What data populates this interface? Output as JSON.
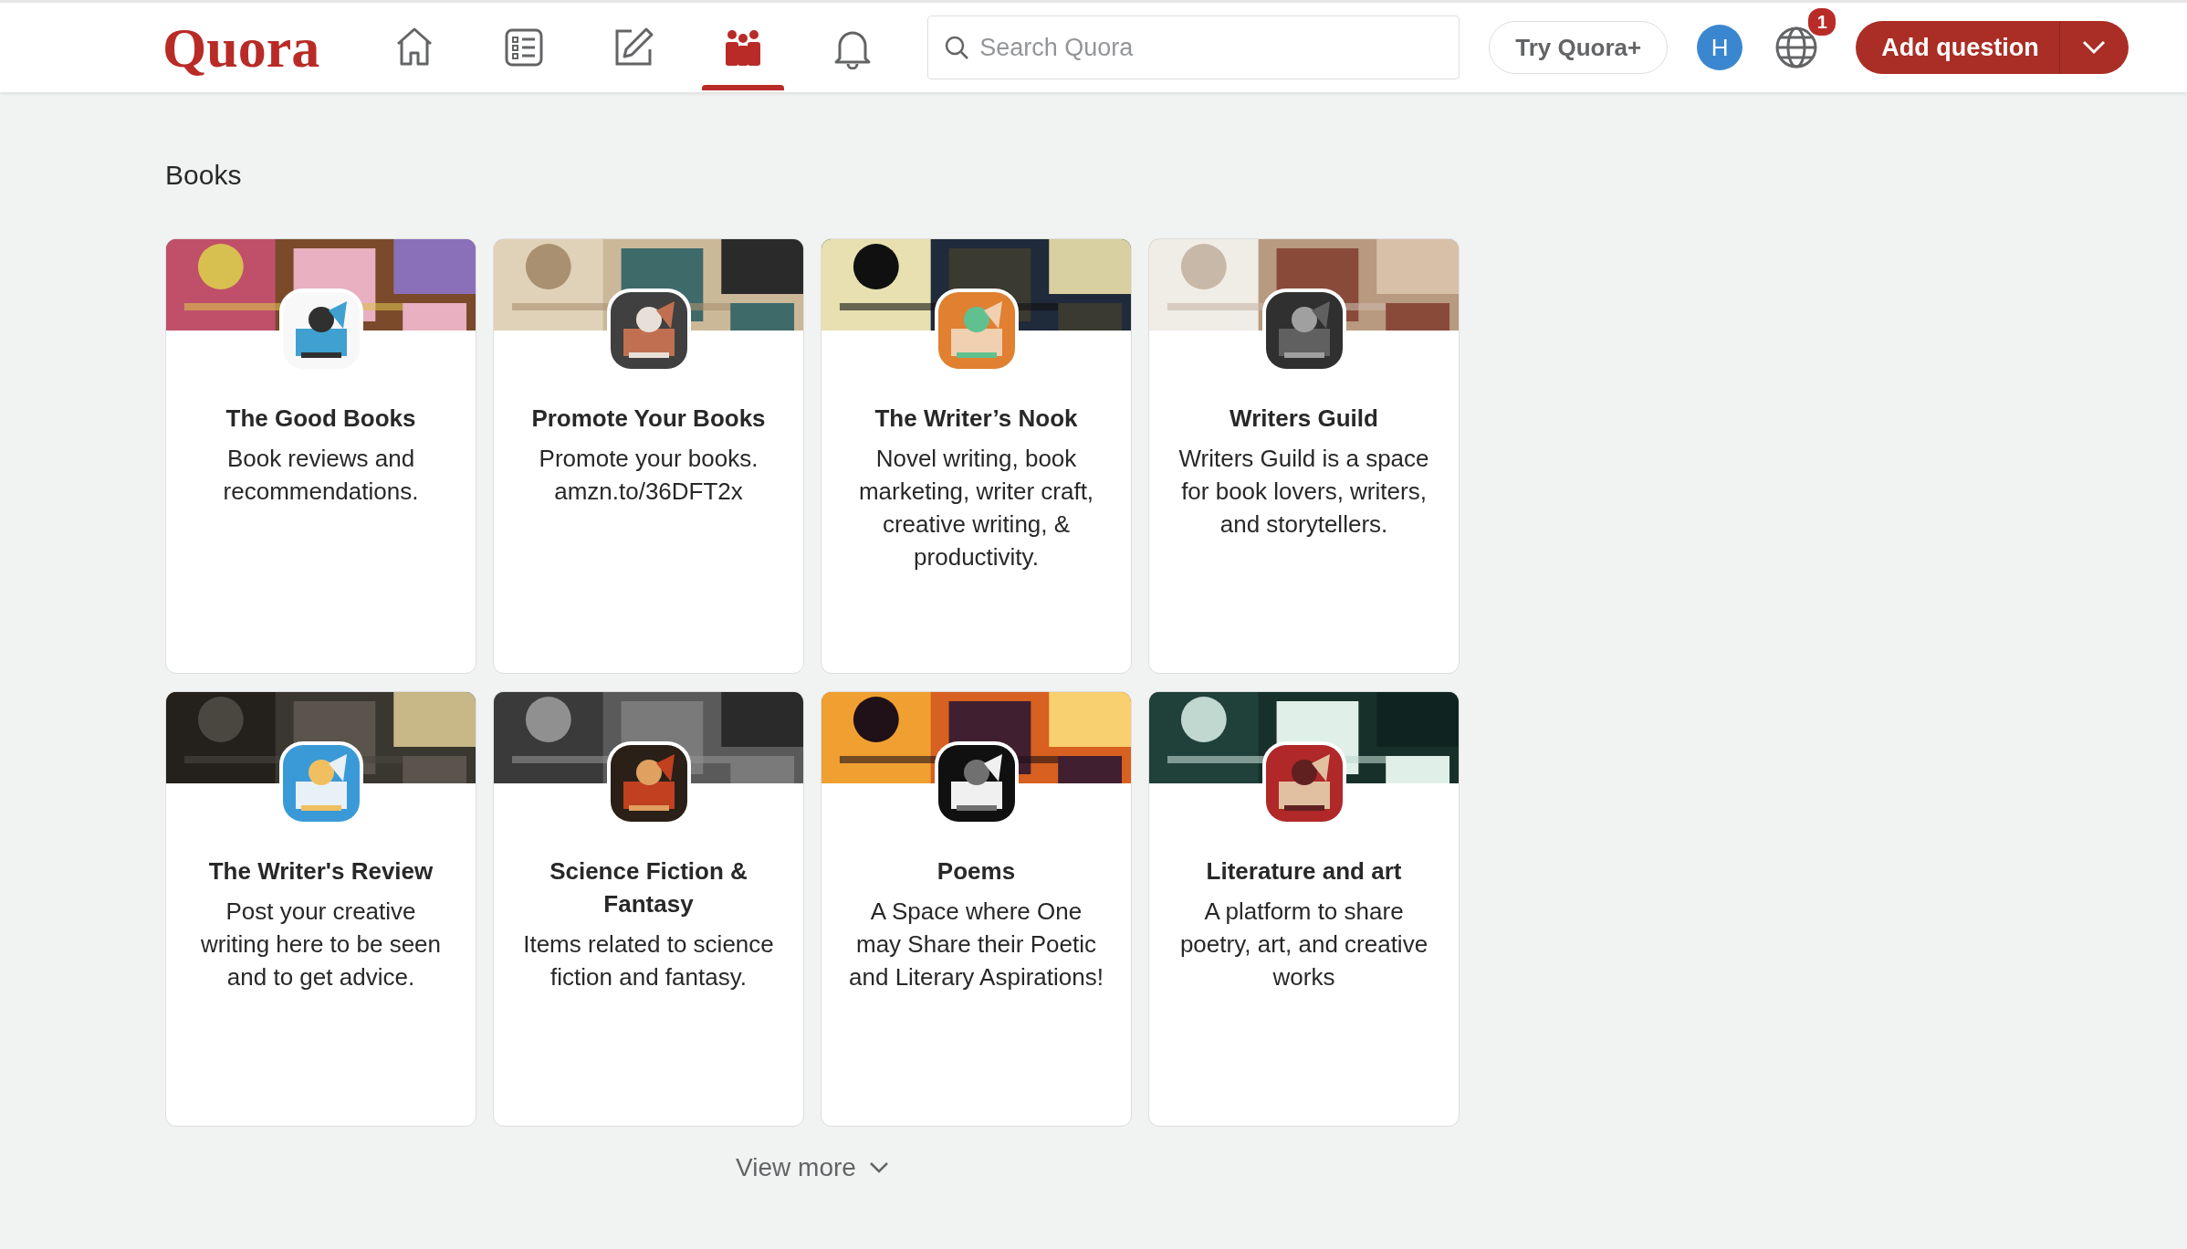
{
  "header": {
    "logo": "Quora",
    "nav": [
      {
        "kind": "home",
        "selected": false
      },
      {
        "kind": "list",
        "selected": false
      },
      {
        "kind": "edit",
        "selected": false
      },
      {
        "kind": "people",
        "selected": true
      },
      {
        "kind": "bell",
        "selected": false
      }
    ],
    "search": {
      "placeholder": "Search Quora"
    },
    "try_plus": "Try Quora+",
    "avatar": "H",
    "globe_badge": "1",
    "add_question": "Add question"
  },
  "section": {
    "title": "Books",
    "spaces": [
      {
        "name": "The Good Books",
        "description": "Book reviews and recommendations."
      },
      {
        "name": "Promote Your Books",
        "description": "Promote your books. amzn.to/36DFT2x"
      },
      {
        "name": "The Writer’s Nook",
        "description": "Novel writing, book marketing, writer craft, creative writing, & productivity."
      },
      {
        "name": "Writers Guild",
        "description": "Writers Guild is a space for book lovers, writers, and storytellers."
      },
      {
        "name": "The Writer's Review",
        "description": "Post your creative writing here to be seen and to get advice."
      },
      {
        "name": "Science Fiction & Fantasy",
        "description": "Items related to science fiction and fantasy."
      },
      {
        "name": "Poems",
        "description": "A Space where One may Share their Poetic and Literary Aspirations!"
      },
      {
        "name": "Literature and art",
        "description": "A platform to share poetry, art, and creative works"
      }
    ],
    "view_more": "View more"
  }
}
